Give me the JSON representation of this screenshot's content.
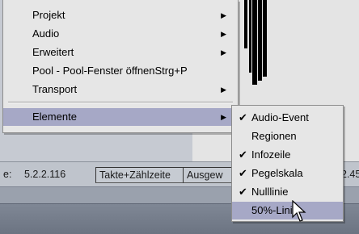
{
  "main_menu": {
    "items": [
      {
        "label": "Projekt",
        "has_submenu": true
      },
      {
        "label": "Audio",
        "has_submenu": true
      },
      {
        "label": "Erweitert",
        "has_submenu": true
      },
      {
        "label": "Pool - Pool-Fenster öffnenStrg+P",
        "has_submenu": false
      },
      {
        "label": "Transport",
        "has_submenu": true
      },
      {
        "label": "Elemente",
        "has_submenu": true,
        "highlighted": true
      }
    ]
  },
  "submenu": {
    "items": [
      {
        "label": "Audio-Event",
        "checked": true
      },
      {
        "label": "Regionen",
        "checked": false
      },
      {
        "label": "Infozeile",
        "checked": true
      },
      {
        "label": "Pegelskala",
        "checked": true
      },
      {
        "label": "Nulllinie",
        "checked": true
      },
      {
        "label": "50%-Linie",
        "checked": false,
        "highlighted": true
      }
    ]
  },
  "statusbar": {
    "position_prefix": "e:",
    "position_value": "5.2.2.116",
    "timebase": "Takte+Zählzeite",
    "selection_label": "Ausgew",
    "right_value": "2.45"
  },
  "colors": {
    "menu_bg": "#e6e6e6",
    "highlight": "#a6a8c6",
    "statusbar": "#bfc4cc"
  }
}
